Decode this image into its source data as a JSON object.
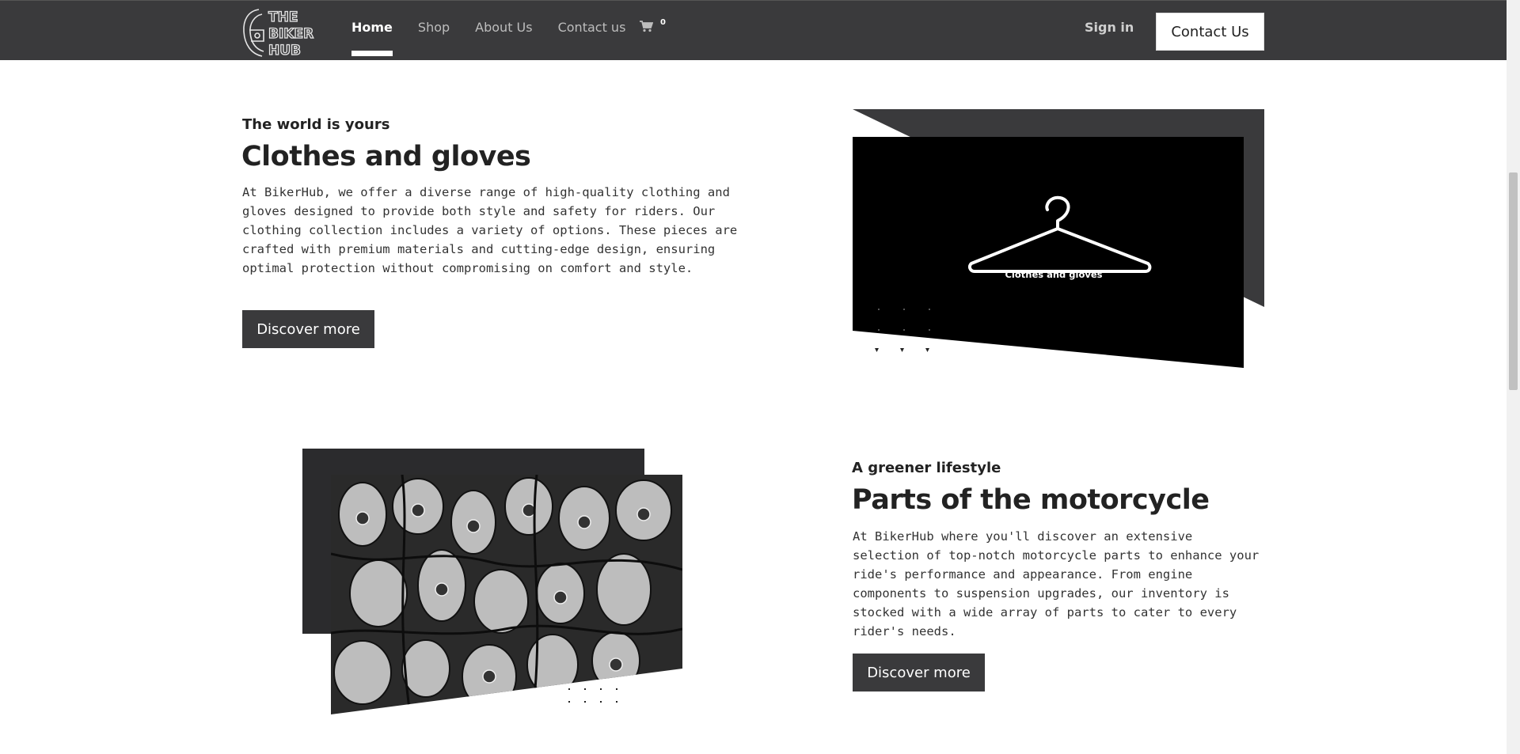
{
  "nav": {
    "logo_text": "THE BIKER HUB",
    "links": [
      {
        "label": "Home",
        "active": true
      },
      {
        "label": "Shop",
        "active": false
      },
      {
        "label": "About Us",
        "active": false
      },
      {
        "label": "Contact us",
        "active": false
      }
    ],
    "cart_icon": "shopping-cart-icon",
    "cart_count": "0",
    "sign_in": "Sign in",
    "contact_button": "Contact Us"
  },
  "section1": {
    "eyebrow": "The world is yours",
    "heading": "Clothes and gloves",
    "paragraph": "At BikerHub, we offer a diverse range of high-quality clothing and gloves designed to provide both style and safety for riders. Our clothing collection includes a variety of options. These pieces are crafted with premium materials and cutting-edge design, ensuring optimal protection without compromising on comfort and style.",
    "button": "Discover more",
    "image_caption": "Clothes and gloves"
  },
  "section2": {
    "eyebrow": "A greener lifestyle",
    "heading": "Parts of the motorcycle",
    "paragraph": "At BikerHub where you'll discover an extensive selection of top-notch motorcycle parts to enhance your ride's performance and appearance. From engine components to suspension upgrades, our inventory is stocked with a wide array of parts to cater to every rider's needs.",
    "button": "Discover more"
  },
  "colors": {
    "navbar": "#3a3a3c",
    "accent_dark": "#2b2b2d",
    "white": "#ffffff"
  }
}
